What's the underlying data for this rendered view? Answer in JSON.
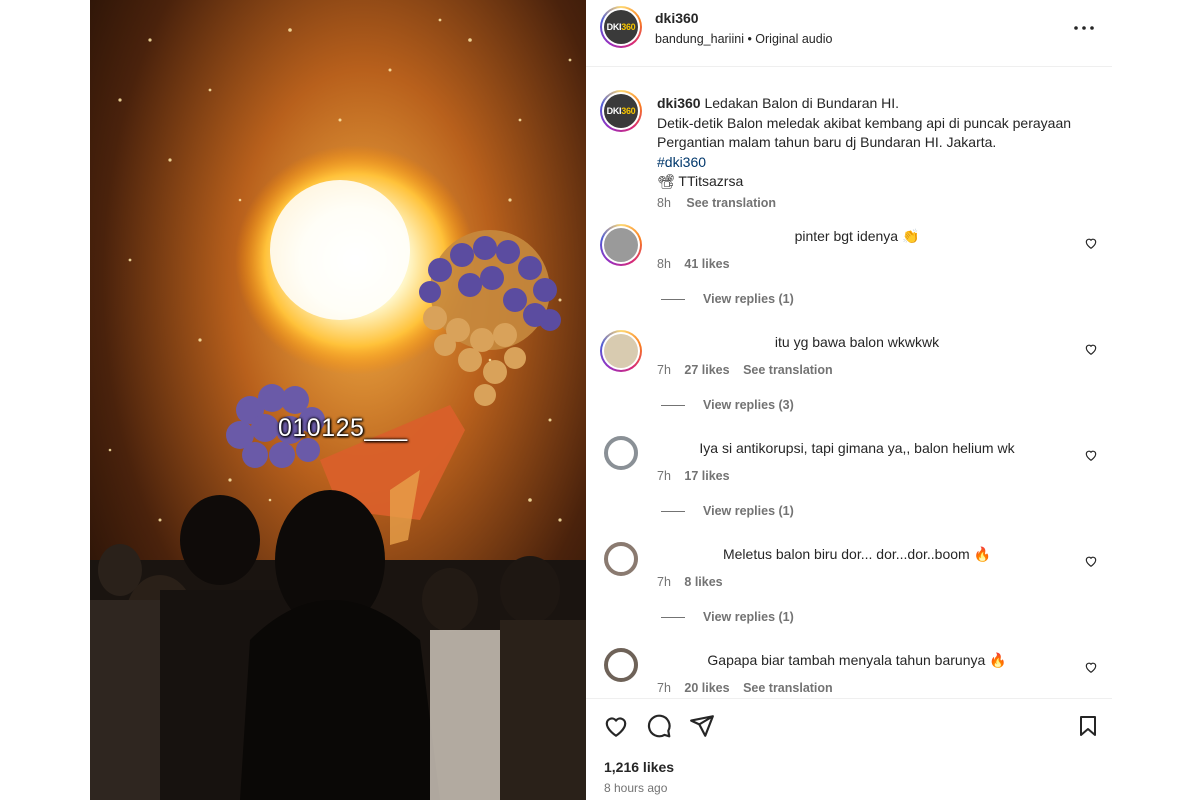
{
  "media": {
    "overlay_text": "010125___"
  },
  "header": {
    "username": "dki360",
    "audio_source": "bandung_hariini",
    "audio_sep": " • ",
    "audio_label": "Original audio"
  },
  "caption": {
    "username": "dki360",
    "title": "Ledakan Balon di Bundaran HI.",
    "body": "Detik-detik Balon meledak akibat kembang api di puncak perayaan Pergantian malam tahun baru dj Bundaran HI. Jakarta.",
    "hashtag": "#dki360",
    "credit_emoji": "📽",
    "credit": "TTitsazrsa",
    "time": "8h",
    "see_translation": "See translation"
  },
  "comments": [
    {
      "text": "pinter bgt idenya 👏",
      "time": "8h",
      "likes": "41 likes",
      "see_translation": "",
      "replies": "View replies (1)"
    },
    {
      "text": "itu yg bawa balon wkwkwk",
      "time": "7h",
      "likes": "27 likes",
      "see_translation": "See translation",
      "replies": "View replies (3)"
    },
    {
      "text": "Iya si antikorupsi, tapi gimana ya,, balon helium wk",
      "time": "7h",
      "likes": "17 likes",
      "see_translation": "",
      "replies": "View replies (1)"
    },
    {
      "text": "Meletus balon biru dor... dor...dor..boom 🔥",
      "time": "7h",
      "likes": "8 likes",
      "see_translation": "",
      "replies": "View replies (1)"
    },
    {
      "text": "Gapapa biar tambah menyala tahun barunya 🔥",
      "time": "7h",
      "likes": "20 likes",
      "see_translation": "See translation",
      "replies": ""
    }
  ],
  "footer": {
    "likes": "1,216 likes",
    "time": "8 hours ago"
  },
  "logo": {
    "text_a": "DKI",
    "text_b": "360"
  },
  "colors": {
    "link": "#00376b",
    "muted": "#737373",
    "text": "#262626"
  }
}
